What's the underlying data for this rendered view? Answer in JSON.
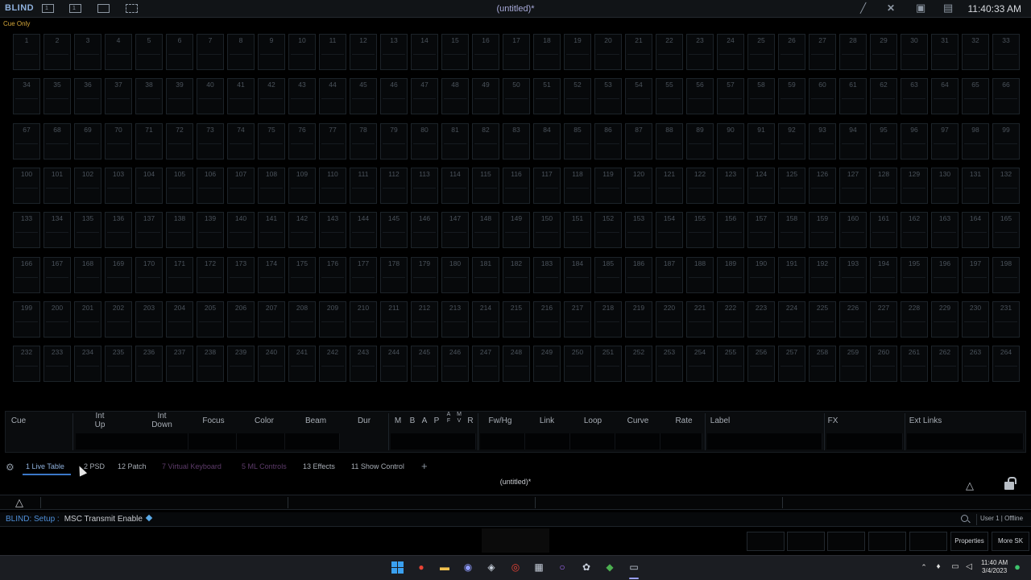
{
  "topbar": {
    "mode": "BLIND",
    "title": "(untitled)*",
    "clock": "11:40:33 AM",
    "icons": [
      "display-1-icon",
      "display-1-outline-icon",
      "window-icon",
      "dashed-window-icon",
      "pen-icon",
      "tools-icon",
      "camera-icon",
      "keyboard-icon"
    ]
  },
  "cue_only": "Cue Only",
  "grid": {
    "rows": 8,
    "cols": 33,
    "first_channel": 1,
    "last_channel": 264
  },
  "cue_header": {
    "columns": [
      "Cue",
      "Int\nUp",
      "Int\nDown",
      "Focus",
      "Color",
      "Beam",
      "Dur",
      "M",
      "B",
      "A",
      "P",
      "A F",
      "M V",
      "R",
      "Fw/Hg",
      "Link",
      "Loop",
      "Curve",
      "Rate",
      "Label",
      "FX",
      "Ext Links"
    ]
  },
  "tabs": [
    {
      "label": "1 Live Table",
      "state": "active"
    },
    {
      "label": "2 PSD",
      "state": "normal"
    },
    {
      "label": "12 Patch",
      "state": "normal"
    },
    {
      "label": "7 Virtual Keyboard",
      "state": "dim"
    },
    {
      "label": "5 ML Controls",
      "state": "dim"
    },
    {
      "label": "13 Effects",
      "state": "normal"
    },
    {
      "label": "11 Show Control",
      "state": "normal"
    }
  ],
  "tab_plus": "+",
  "sub_title": "(untitled)*",
  "command_line": {
    "mode": "BLIND: Setup :",
    "target": "MSC Transmit Enable",
    "user": "User 1 | Offline"
  },
  "softkeys": [
    "",
    "",
    "",
    "",
    "",
    "Properties",
    "More SK"
  ],
  "taskbar": {
    "time": "11:40 AM",
    "date": "3/4/2023"
  },
  "colors": {
    "accent": "#3b78c8",
    "mode_text": "#4f8fd8",
    "cue_only": "#d4a73a",
    "dim_tab": "#5d3b6a"
  }
}
